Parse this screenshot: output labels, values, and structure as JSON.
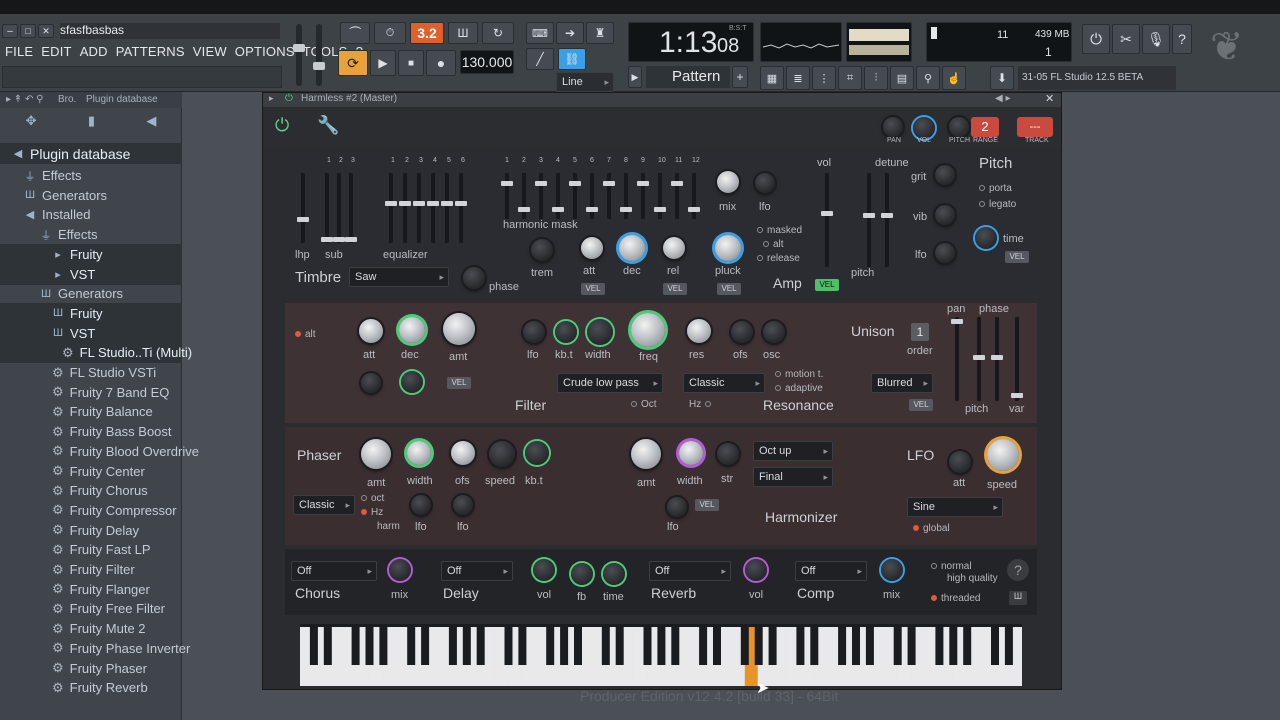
{
  "app": {
    "project_name": "sfasfbasbas",
    "menu": [
      "FILE",
      "EDIT",
      "ADD",
      "PATTERNS",
      "VIEW",
      "OPTIONS",
      "TOOLS",
      "?"
    ]
  },
  "transport": {
    "pattern_mode": "3.2",
    "tempo": "130.000",
    "time": "1:13",
    "time_sub": "08",
    "time_label": "B:S:T",
    "snap": "Line",
    "pattern": "Pattern 1"
  },
  "cpu": {
    "value": "11",
    "mem": "439 MB",
    "poly": "1"
  },
  "hint": {
    "text": "31-05  FL Studio 12.5 BETA"
  },
  "browser": {
    "tabs": [
      "Bro.",
      "Plugin database"
    ],
    "root": "Plugin database",
    "items": [
      {
        "label": "Effects",
        "icon": "plug-icon",
        "level": 1
      },
      {
        "label": "Generators",
        "icon": "piano-icon",
        "level": 1
      },
      {
        "label": "Installed",
        "icon": "speaker-icon",
        "level": 1
      },
      {
        "label": "Effects",
        "icon": "plug-icon",
        "level": 2
      },
      {
        "label": "Fruity",
        "icon": "folder-icon",
        "level": 3
      },
      {
        "label": "VST",
        "icon": "folder-icon",
        "level": 3
      },
      {
        "label": "Generators",
        "icon": "piano-icon",
        "level": 2
      },
      {
        "label": "Fruity",
        "icon": "piano-icon",
        "level": 3
      },
      {
        "label": "VST",
        "icon": "piano-icon",
        "level": 3
      },
      {
        "label": "FL Studio..Ti (Multi)",
        "icon": "gear-icon",
        "level": 4
      },
      {
        "label": "FL Studio VSTi",
        "icon": "gear-icon",
        "level": 3
      },
      {
        "label": "Fruity 7 Band EQ",
        "icon": "gear-icon",
        "level": 3
      },
      {
        "label": "Fruity Balance",
        "icon": "gear-icon",
        "level": 3
      },
      {
        "label": "Fruity Bass Boost",
        "icon": "gear-icon",
        "level": 3
      },
      {
        "label": "Fruity Blood Overdrive",
        "icon": "gear-icon",
        "level": 3
      },
      {
        "label": "Fruity Center",
        "icon": "gear-icon",
        "level": 3
      },
      {
        "label": "Fruity Chorus",
        "icon": "gear-icon",
        "level": 3
      },
      {
        "label": "Fruity Compressor",
        "icon": "gear-icon",
        "level": 3
      },
      {
        "label": "Fruity Delay",
        "icon": "gear-icon",
        "level": 3
      },
      {
        "label": "Fruity Fast LP",
        "icon": "gear-icon",
        "level": 3
      },
      {
        "label": "Fruity Filter",
        "icon": "gear-icon",
        "level": 3
      },
      {
        "label": "Fruity Flanger",
        "icon": "gear-icon",
        "level": 3
      },
      {
        "label": "Fruity Free Filter",
        "icon": "gear-icon",
        "level": 3
      },
      {
        "label": "Fruity Mute 2",
        "icon": "gear-icon",
        "level": 3
      },
      {
        "label": "Fruity Phase Inverter",
        "icon": "gear-icon",
        "level": 3
      },
      {
        "label": "Fruity Phaser",
        "icon": "gear-icon",
        "level": 3
      },
      {
        "label": "Fruity Reverb",
        "icon": "gear-icon",
        "level": 3
      }
    ]
  },
  "plugin": {
    "window_title": "Harmless #2 (Master)",
    "head_labels": {
      "pan": "PAN",
      "vol": "VOL",
      "pitch": "PITCH",
      "range": "RANGE",
      "track": "TRACK",
      "range_value": "2",
      "track_value": "---"
    },
    "timbre": {
      "title": "Timbre",
      "dropdown": "Saw",
      "phase": "phase",
      "lhp": "lhp",
      "sub": "sub",
      "equalizer": "equalizer",
      "harmonic_mask": "harmonic mask",
      "mix": "mix",
      "lfo": "lfo",
      "trem": "trem",
      "att": "att",
      "dec": "dec",
      "rel": "rel",
      "pluck": "pluck",
      "vel": "VEL",
      "masked": "masked",
      "alt": "alt",
      "release": "release",
      "amp": "Amp",
      "amp_vel": "VEL",
      "eq_numbers": [
        "1",
        "2",
        "3",
        "4",
        "5",
        "6"
      ],
      "mask_numbers": [
        "1",
        "2",
        "3",
        "4",
        "5",
        "6",
        "7",
        "8",
        "9",
        "10",
        "11",
        "12"
      ],
      "sub_numbers": [
        "1",
        "2",
        "3"
      ]
    },
    "pitch": {
      "title": "Pitch",
      "vol": "vol",
      "detune": "detune",
      "grit": "grit",
      "vib": "vib",
      "lfo": "lfo",
      "pitch": "pitch",
      "porta": "porta",
      "legato": "legato",
      "time": "time",
      "vel": "VEL"
    },
    "filter": {
      "title": "Filter",
      "alt": "alt",
      "att": "att",
      "dec": "dec",
      "amt": "amt",
      "lfo": "lfo",
      "kbt": "kb.t",
      "width": "width",
      "freq": "freq",
      "res": "res",
      "ofs": "ofs",
      "osc": "osc",
      "vel": "VEL",
      "type": "Crude low pass",
      "oct": "Oct",
      "hz": "Hz"
    },
    "resonance": {
      "title": "Resonance",
      "type": "Classic",
      "motion": "motion t.",
      "adaptive": "adaptive"
    },
    "unison": {
      "title": "Unison",
      "order_value": "1",
      "order": "order",
      "pan": "pan",
      "phase": "phase",
      "pitch": "pitch",
      "var": "var",
      "mode": "Blurred",
      "vel": "VEL"
    },
    "phaser": {
      "title": "Phaser",
      "amt": "amt",
      "width": "width",
      "ofs": "ofs",
      "speed": "speed",
      "kbt": "kb.t",
      "mode": "Classic",
      "oct": "oct",
      "hz": "Hz",
      "harm": "harm",
      "lfo": "lfo",
      "lfo2": "lfo"
    },
    "harmonizer": {
      "title": "Harmonizer",
      "amt": "amt",
      "width": "width",
      "str": "str",
      "lfo": "lfo",
      "vel": "VEL",
      "dd1": "Oct up",
      "dd2": "Final"
    },
    "lfo": {
      "title": "LFO",
      "att": "att",
      "speed": "speed",
      "shape": "Sine",
      "global": "global"
    },
    "fx": {
      "chorus": "Chorus",
      "chorus_dd": "Off",
      "mix": "mix",
      "delay": "Delay",
      "delay_dd": "Off",
      "vol": "vol",
      "fb": "fb",
      "time": "time",
      "reverb": "Reverb",
      "reverb_dd": "Off",
      "rvol": "vol",
      "comp": "Comp",
      "comp_dd": "Off",
      "cmix": "mix",
      "normal": "normal",
      "high": "high quality",
      "threaded": "threaded"
    }
  },
  "status": {
    "edition": "Producer Edition v12.4.2 [build 33] - 64Bit"
  }
}
